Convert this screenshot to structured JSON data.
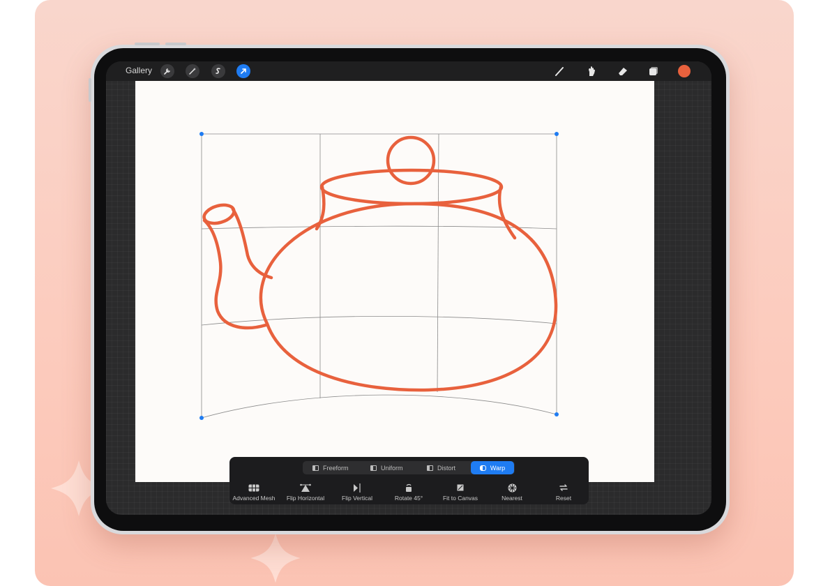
{
  "topbar": {
    "gallery_label": "Gallery",
    "left_icons": [
      "wrench-icon",
      "magic-wand-icon",
      "selection-icon",
      "transform-arrow-icon"
    ],
    "right_tools": [
      "brush-icon",
      "smudge-icon",
      "eraser-icon",
      "layers-icon"
    ],
    "current_color": "#e8613d",
    "accent_color": "#1f7cf2"
  },
  "transform_modes": [
    {
      "label": "Freeform",
      "active": false
    },
    {
      "label": "Uniform",
      "active": false
    },
    {
      "label": "Distort",
      "active": false
    },
    {
      "label": "Warp",
      "active": true
    }
  ],
  "actions": [
    {
      "label": "Advanced Mesh",
      "icon": "mesh-icon"
    },
    {
      "label": "Flip Horizontal",
      "icon": "flip-horizontal-icon"
    },
    {
      "label": "Flip Vertical",
      "icon": "flip-vertical-icon"
    },
    {
      "label": "Rotate 45°",
      "icon": "rotate-icon"
    },
    {
      "label": "Fit to Canvas",
      "icon": "fit-to-canvas-icon"
    },
    {
      "label": "Nearest",
      "icon": "nearest-icon"
    },
    {
      "label": "Reset",
      "icon": "reset-icon"
    }
  ],
  "drawing": {
    "subject": "teapot-sketch",
    "stroke_color": "#e8613d"
  }
}
